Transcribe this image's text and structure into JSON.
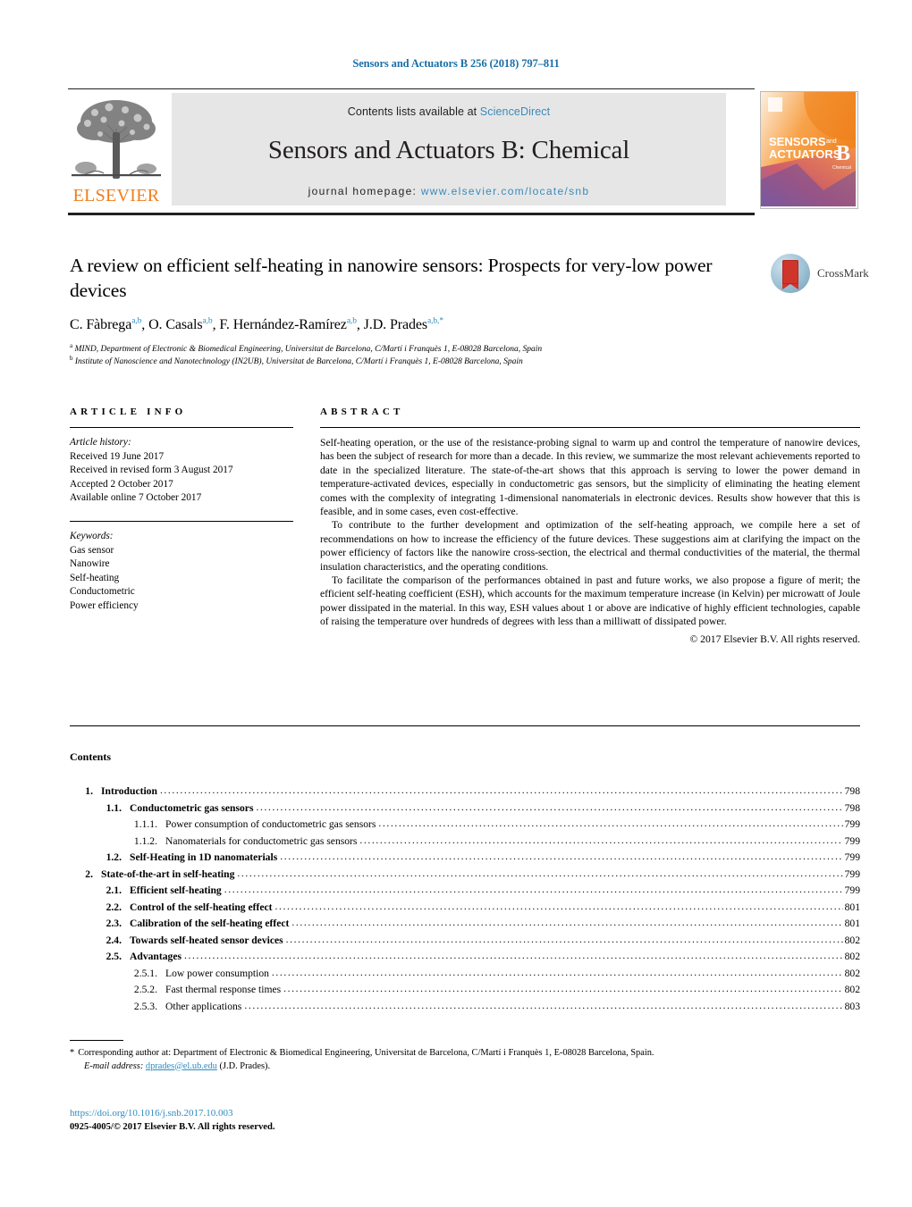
{
  "running_head": "Sensors and Actuators B 256 (2018) 797–811",
  "masthead": {
    "contents_prefix": "Contents lists available at ",
    "sciencedirect": "ScienceDirect",
    "journal_title": "Sensors and Actuators B: Chemical",
    "homepage_prefix": "journal homepage: ",
    "homepage_url": "www.elsevier.com/locate/snb",
    "publisher_logo_text": "ELSEVIER",
    "cover_line1": "SENSORS",
    "cover_and": "and",
    "cover_line2": "ACTUATORS",
    "cover_letter": "B",
    "cover_sub": "Chemical",
    "link_color": "#3a8bbb",
    "elsevier_orange": "#ef7f1a"
  },
  "article": {
    "title": "A review on efficient self-heating in nanowire sensors: Prospects for very-low power devices",
    "authors": [
      {
        "name": "C. Fàbrega",
        "sup": "a,b"
      },
      {
        "name": "O. Casals",
        "sup": "a,b"
      },
      {
        "name": "F. Hernández-Ramírez",
        "sup": "a,b"
      },
      {
        "name": "J.D. Prades",
        "sup": "a,b,*"
      }
    ],
    "affiliations": [
      {
        "marker": "a",
        "text": "MIND, Department of Electronic & Biomedical Engineering, Universitat de Barcelona, C/Martí i Franquès 1, E-08028 Barcelona, Spain"
      },
      {
        "marker": "b",
        "text": "Institute of Nanoscience and Nanotechnology (IN2UB), Universitat de Barcelona, C/Martí i Franquès 1, E-08028 Barcelona, Spain"
      }
    ],
    "crossmark_label": "CrossMark"
  },
  "info": {
    "heading": "ARTICLE INFO",
    "history_label": "Article history:",
    "history": [
      "Received 19 June 2017",
      "Received in revised form 3 August 2017",
      "Accepted 2 October 2017",
      "Available online 7 October 2017"
    ],
    "keywords_label": "Keywords:",
    "keywords": [
      "Gas sensor",
      "Nanowire",
      "Self-heating",
      "Conductometric",
      "Power efficiency"
    ]
  },
  "abstract": {
    "heading": "ABSTRACT",
    "paragraphs": [
      "Self-heating operation, or the use of the resistance-probing signal to warm up and control the temperature of nanowire devices, has been the subject of research for more than a decade. In this review, we summarize the most relevant achievements reported to date in the specialized literature. The state-of-the-art shows that this approach is serving to lower the power demand in temperature-activated devices, especially in conductometric gas sensors, but the simplicity of eliminating the heating element comes with the complexity of integrating 1-dimensional nanomaterials in electronic devices. Results show however that this is feasible, and in some cases, even cost-effective.",
      "To contribute to the further development and optimization of the self-heating approach, we compile here a set of recommendations on how to increase the efficiency of the future devices. These suggestions aim at clarifying the impact on the power efficiency of factors like the nanowire cross-section, the electrical and thermal conductivities of the material, the thermal insulation characteristics, and the operating conditions.",
      "To facilitate the comparison of the performances obtained in past and future works, we also propose a figure of merit; the efficient self-heating coefficient (ESH), which accounts for the maximum temperature increase (in Kelvin) per microwatt of Joule power dissipated in the material. In this way, ESH values about 1 or above are indicative of highly efficient technologies, capable of raising the temperature over hundreds of degrees with less than a milliwatt of dissipated power."
    ],
    "copyright": "© 2017 Elsevier B.V. All rights reserved."
  },
  "contents": {
    "heading": "Contents",
    "entries": [
      {
        "level": 1,
        "num": "1.",
        "label": "Introduction",
        "page": "798"
      },
      {
        "level": 2,
        "num": "1.1.",
        "label": "Conductometric gas sensors",
        "page": "798"
      },
      {
        "level": 3,
        "num": "1.1.1.",
        "label": "Power consumption of conductometric gas sensors",
        "page": "799"
      },
      {
        "level": 3,
        "num": "1.1.2.",
        "label": "Nanomaterials for conductometric gas sensors",
        "page": "799"
      },
      {
        "level": 2,
        "num": "1.2.",
        "label": "Self-Heating in 1D nanomaterials",
        "page": "799"
      },
      {
        "level": 1,
        "num": "2.",
        "label": "State-of-the-art in self-heating",
        "page": "799"
      },
      {
        "level": 2,
        "num": "2.1.",
        "label": "Efficient self-heating",
        "page": "799"
      },
      {
        "level": 2,
        "num": "2.2.",
        "label": "Control of the self-heating effect",
        "page": "801"
      },
      {
        "level": 2,
        "num": "2.3.",
        "label": "Calibration of the self-heating effect",
        "page": "801"
      },
      {
        "level": 2,
        "num": "2.4.",
        "label": "Towards self-heated sensor devices",
        "page": "802"
      },
      {
        "level": 2,
        "num": "2.5.",
        "label": "Advantages",
        "page": "802"
      },
      {
        "level": 3,
        "num": "2.5.1.",
        "label": "Low power consumption",
        "page": "802"
      },
      {
        "level": 3,
        "num": "2.5.2.",
        "label": "Fast thermal response times",
        "page": "802"
      },
      {
        "level": 3,
        "num": "2.5.3.",
        "label": "Other applications",
        "page": "803"
      }
    ]
  },
  "footer": {
    "corresponding_marker": "*",
    "corresponding_text": "Corresponding author at: Department of Electronic & Biomedical Engineering, Universitat de Barcelona, C/Martí i Franquès 1, E-08028 Barcelona, Spain.",
    "email_label": "E-mail address:",
    "email": "dprades@el.ub.edu",
    "email_suffix": "(J.D. Prades).",
    "doi": "https://doi.org/10.1016/j.snb.2017.10.003",
    "issn_line": "0925-4005/© 2017 Elsevier B.V. All rights reserved."
  }
}
